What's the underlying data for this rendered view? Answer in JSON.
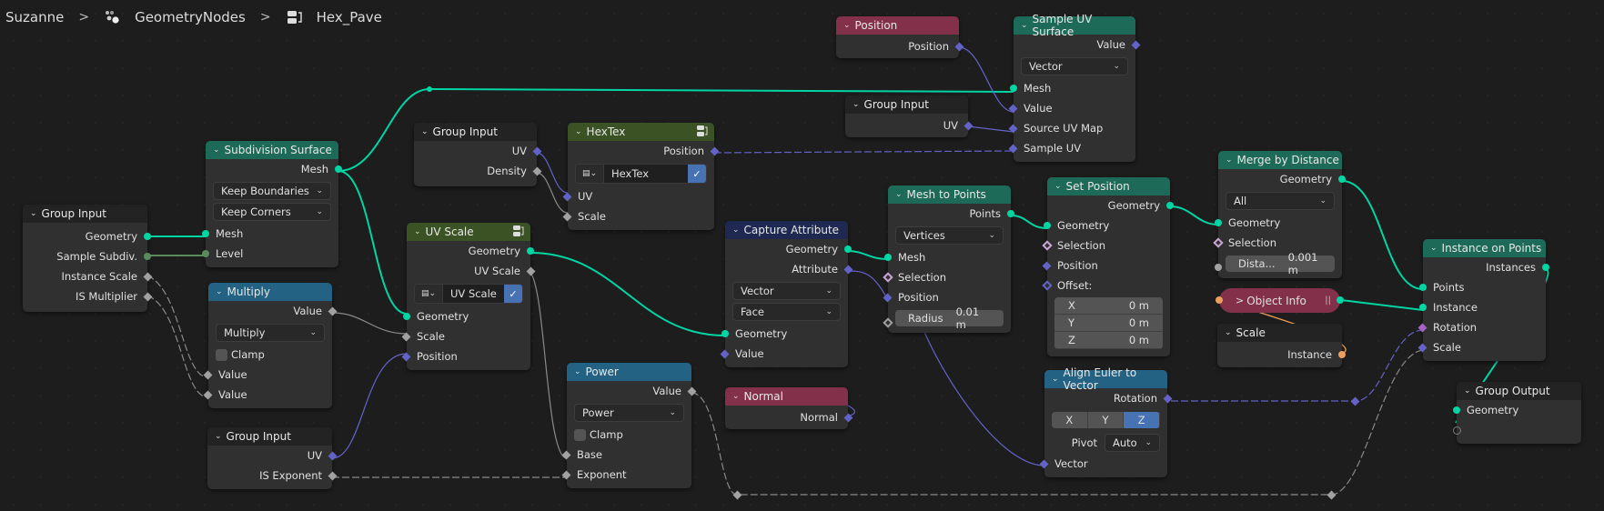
{
  "breadcrumb": {
    "object": "Suzanne",
    "modifier": "GeometryNodes",
    "node_group": "Hex_Pave",
    "modifier_icon": "geometry-nodes-icon",
    "group_icon": "node-group-icon"
  },
  "nodes": {
    "group_input_main": {
      "title": "Group Input",
      "outputs": [
        "Geometry",
        "Sample Subdiv.",
        "Instance Scale",
        "IS Multiplier"
      ]
    },
    "subdivision_surface": {
      "title": "Subdivision Surface",
      "output": "Mesh",
      "uv_smooth": "Keep Boundaries",
      "boundary_smooth": "Keep Corners",
      "inputs": [
        "Mesh",
        "Level"
      ]
    },
    "group_input_uv_density": {
      "title": "Group Input",
      "outputs": [
        "UV",
        "Density"
      ]
    },
    "hextex": {
      "title": "HexTex",
      "output": "Position",
      "datablock": "HexTex",
      "inputs": [
        "UV",
        "Scale"
      ]
    },
    "uv_scale": {
      "title": "UV Scale",
      "outputs": [
        "Geometry",
        "UV Scale"
      ],
      "datablock": "UV Scale",
      "inputs": [
        "Geometry",
        "Scale",
        "Position"
      ]
    },
    "multiply": {
      "title": "Multiply",
      "output": "Value",
      "operation": "Multiply",
      "clamp_label": "Clamp",
      "clamp": false,
      "inputs": [
        "Value",
        "Value"
      ]
    },
    "group_input_uv_exponent": {
      "title": "Group Input",
      "outputs": [
        "UV",
        "IS Exponent"
      ]
    },
    "power": {
      "title": "Power",
      "output": "Value",
      "operation": "Power",
      "clamp_label": "Clamp",
      "clamp": false,
      "inputs": [
        "Base",
        "Exponent"
      ]
    },
    "capture_attribute": {
      "title": "Capture Attribute",
      "outputs": [
        "Geometry",
        "Attribute"
      ],
      "data_type": "Vector",
      "domain": "Face",
      "inputs": [
        "Geometry",
        "Value"
      ]
    },
    "normal": {
      "title": "Normal",
      "output": "Normal"
    },
    "mesh_to_points": {
      "title": "Mesh to Points",
      "output": "Points",
      "mode": "Vertices",
      "inputs": [
        "Mesh",
        "Selection",
        "Position"
      ],
      "radius_label": "Radius",
      "radius_value": "0.01 m"
    },
    "position": {
      "title": "Position",
      "output": "Position"
    },
    "group_input_uv": {
      "title": "Group Input",
      "output": "UV"
    },
    "sample_uv_surface": {
      "title": "Sample UV Surface",
      "output": "Value",
      "data_type": "Vector",
      "inputs": [
        "Mesh",
        "Value",
        "Source UV Map",
        "Sample UV"
      ]
    },
    "set_position": {
      "title": "Set Position",
      "output": "Geometry",
      "inputs": [
        "Geometry",
        "Selection",
        "Position",
        "Offset:"
      ],
      "offset": [
        {
          "axis": "X",
          "value": "0 m"
        },
        {
          "axis": "Y",
          "value": "0 m"
        },
        {
          "axis": "Z",
          "value": "0 m"
        }
      ]
    },
    "merge_by_distance": {
      "title": "Merge by Distance",
      "output": "Geometry",
      "mode": "All",
      "inputs": [
        "Geometry",
        "Selection"
      ],
      "distance_label": "Dista...",
      "distance_value": "0.001 m"
    },
    "object_info": {
      "title": "Object Info",
      "collapsed": true
    },
    "scale": {
      "title": "Scale",
      "output": "Instance"
    },
    "align_euler": {
      "title": "Align Euler to Vector",
      "output": "Rotation",
      "axes": [
        "X",
        "Y",
        "Z"
      ],
      "active_axis": "Z",
      "pivot_label": "Pivot",
      "pivot_value": "Auto",
      "input": "Vector"
    },
    "instance_on_points": {
      "title": "Instance on Points",
      "output": "Instances",
      "inputs": [
        "Points",
        "Instance",
        "Rotation",
        "Scale"
      ]
    },
    "group_output": {
      "title": "Group Output",
      "inputs": [
        "Geometry"
      ]
    }
  },
  "colors": {
    "geometry_socket": "#00d6a3",
    "vector_socket": "#6363c7",
    "float_socket": "#a1a1a1",
    "int_socket": "#598c5c",
    "object_socket": "#ed9e5c",
    "rotation_socket": "#a663c7",
    "geometry_header": "#1e6a58",
    "group_header": "#3b5225",
    "math_header": "#246283",
    "input_header": "#83304a",
    "attribute_header": "#1e2850",
    "active_blue": "#4772b3"
  }
}
